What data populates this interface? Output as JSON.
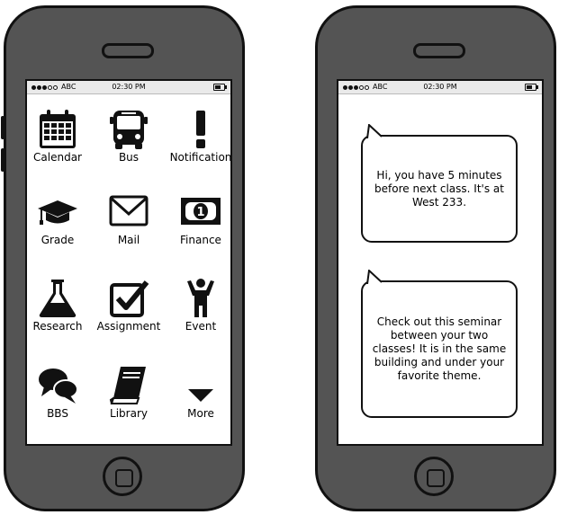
{
  "left_phone": {
    "status": {
      "carrier": "ABC",
      "time": "02:30 PM"
    },
    "apps": [
      {
        "label": "Calendar",
        "icon": "calendar-icon"
      },
      {
        "label": "Bus",
        "icon": "bus-icon"
      },
      {
        "label": "Notification",
        "icon": "exclamation-icon"
      },
      {
        "label": "Grade",
        "icon": "graduation-cap-icon"
      },
      {
        "label": "Mail",
        "icon": "envelope-icon"
      },
      {
        "label": "Finance",
        "icon": "banknote-icon"
      },
      {
        "label": "Research",
        "icon": "flask-icon"
      },
      {
        "label": "Assignment",
        "icon": "checkbox-icon"
      },
      {
        "label": "Event",
        "icon": "person-icon"
      },
      {
        "label": "BBS",
        "icon": "chat-bubbles-icon"
      },
      {
        "label": "Library",
        "icon": "book-icon"
      },
      {
        "label": "More",
        "icon": "triangle-down-icon"
      }
    ]
  },
  "right_phone": {
    "status": {
      "carrier": "ABC",
      "time": "02:30 PM"
    },
    "messages": [
      {
        "text": "Hi, you have 5 minutes before next class. It's at West 233."
      },
      {
        "text": "Check out this seminar between your two classes! It is in the same building and under your favorite theme."
      }
    ]
  },
  "colors": {
    "phone_body": "#545454",
    "outline": "#111111",
    "statusbar": "#eaeaea",
    "screen": "#ffffff"
  }
}
